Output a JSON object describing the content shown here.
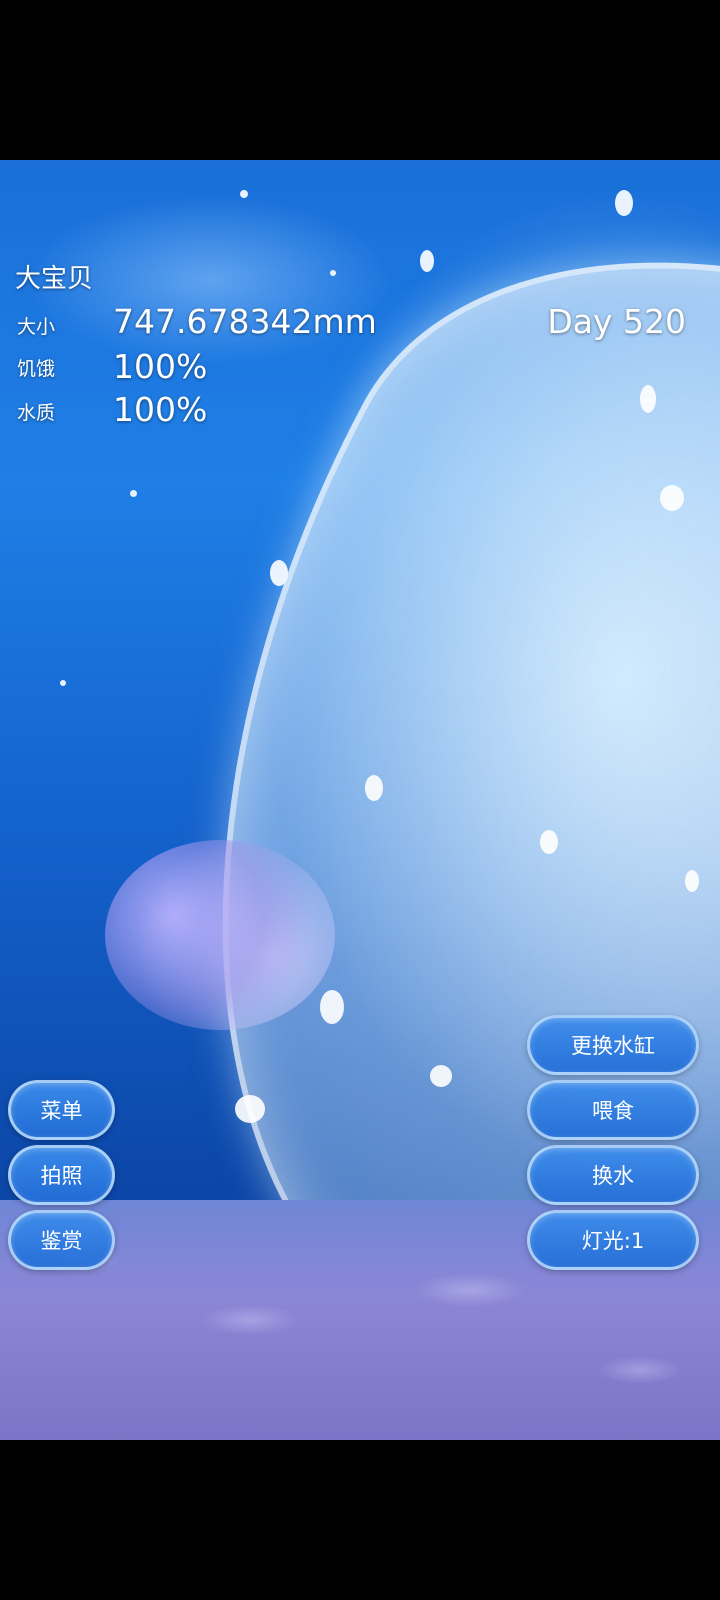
{
  "pet": {
    "name": "大宝贝",
    "day": "Day 520"
  },
  "stats": [
    {
      "label": "大小",
      "value": "747.678342mm"
    },
    {
      "label": "饥饿",
      "value": "100%"
    },
    {
      "label": "水质",
      "value": "100%"
    }
  ],
  "left_buttons": [
    "菜单",
    "拍照",
    "鉴赏"
  ],
  "right_buttons": [
    "更换水缸",
    "喂食",
    "换水",
    "灯光:1"
  ],
  "colors": {
    "water_top": "#1f7fe6",
    "water_bottom": "#0a3a8f",
    "button": "#2f7fe0",
    "seabed": "#8b86d6"
  }
}
